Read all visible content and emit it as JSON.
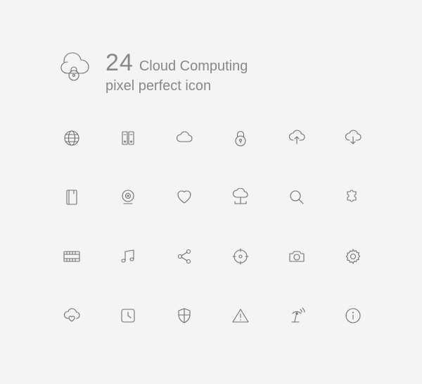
{
  "header": {
    "count": "24",
    "title": "Cloud Computing",
    "subtitle": "pixel perfect icon"
  },
  "hero_icon": "cloud-lock",
  "icons": [
    [
      "globe",
      "servers",
      "cloud",
      "padlock",
      "cloud-upload",
      "cloud-download"
    ],
    [
      "book",
      "webcam",
      "heart",
      "cloud-network",
      "search",
      "puzzle"
    ],
    [
      "film",
      "music",
      "share",
      "target",
      "camera",
      "gear"
    ],
    [
      "cloud-heart",
      "clock",
      "shield",
      "warning",
      "antenna",
      "info"
    ]
  ]
}
